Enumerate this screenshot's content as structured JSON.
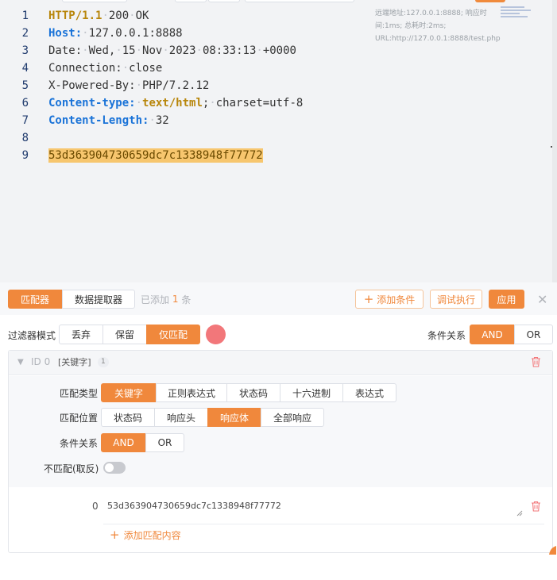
{
  "code_viewer": {
    "lines": [
      {
        "num": "1"
      },
      {
        "num": "2"
      },
      {
        "num": "3"
      },
      {
        "num": "4"
      },
      {
        "num": "5"
      },
      {
        "num": "6"
      },
      {
        "num": "7"
      },
      {
        "num": "8"
      },
      {
        "num": "9"
      }
    ],
    "l1": {
      "proto": "HTTP/1.1",
      "rest": "200",
      "rest2": "OK"
    },
    "l2": {
      "key": "Host:",
      "val": "127.0.0.1:8888"
    },
    "l3": {
      "a": "Date:",
      "b": "Wed,",
      "c": "15",
      "d": "Nov",
      "e": "2023",
      "f": "08:33:13",
      "g": "+0000"
    },
    "l4": {
      "a": "Connection:",
      "b": "close"
    },
    "l5": {
      "a": "X-Powered-By:",
      "b": "PHP/7.2.12"
    },
    "l6": {
      "key": "Content-type:",
      "val": "text/html",
      "semi": ";",
      "rest": "charset=utf-8"
    },
    "l7": {
      "key": "Content-Length:",
      "val": "32"
    },
    "l9": {
      "body": "53d363904730659dc7c1338948f77772"
    },
    "info_text": "远端地址:127.0.0.1:8888; 响应时间:1ms; 总耗时:2ms; URL:http://127.0.0.1:8888/test.php"
  },
  "toolbar": {
    "tab_matcher": "匹配器",
    "tab_extractor": "数据提取器",
    "added_prefix": "已添加",
    "added_count": "1",
    "added_suffix": "条",
    "add_condition": "添加条件",
    "debug_run": "调试执行",
    "apply": "应用"
  },
  "filter": {
    "label": "过滤器模式",
    "options": [
      "丢弃",
      "保留",
      "仅匹配"
    ],
    "selected": "仅匹配",
    "relation_label": "条件关系",
    "relation_options": [
      "AND",
      "OR"
    ],
    "relation_selected": "AND"
  },
  "rule": {
    "id_label": "ID 0",
    "type_tag": "[关键字]",
    "count": "1",
    "match_type_label": "匹配类型",
    "match_types": [
      "关键字",
      "正则表达式",
      "状态码",
      "十六进制",
      "表达式"
    ],
    "match_type_selected": "关键字",
    "match_pos_label": "匹配位置",
    "match_positions": [
      "状态码",
      "响应头",
      "响应体",
      "全部响应"
    ],
    "match_pos_selected": "响应体",
    "relation_label": "条件关系",
    "relation_options": [
      "AND",
      "OR"
    ],
    "relation_selected": "AND",
    "negate_label": "不匹配(取反)",
    "negate_on": false,
    "value_index": "0",
    "value": "53d363904730659dc7c1338948f77772",
    "add_match": "添加匹配内容"
  },
  "colors": {
    "accent": "#f0883c",
    "danger": "#f2777a"
  }
}
